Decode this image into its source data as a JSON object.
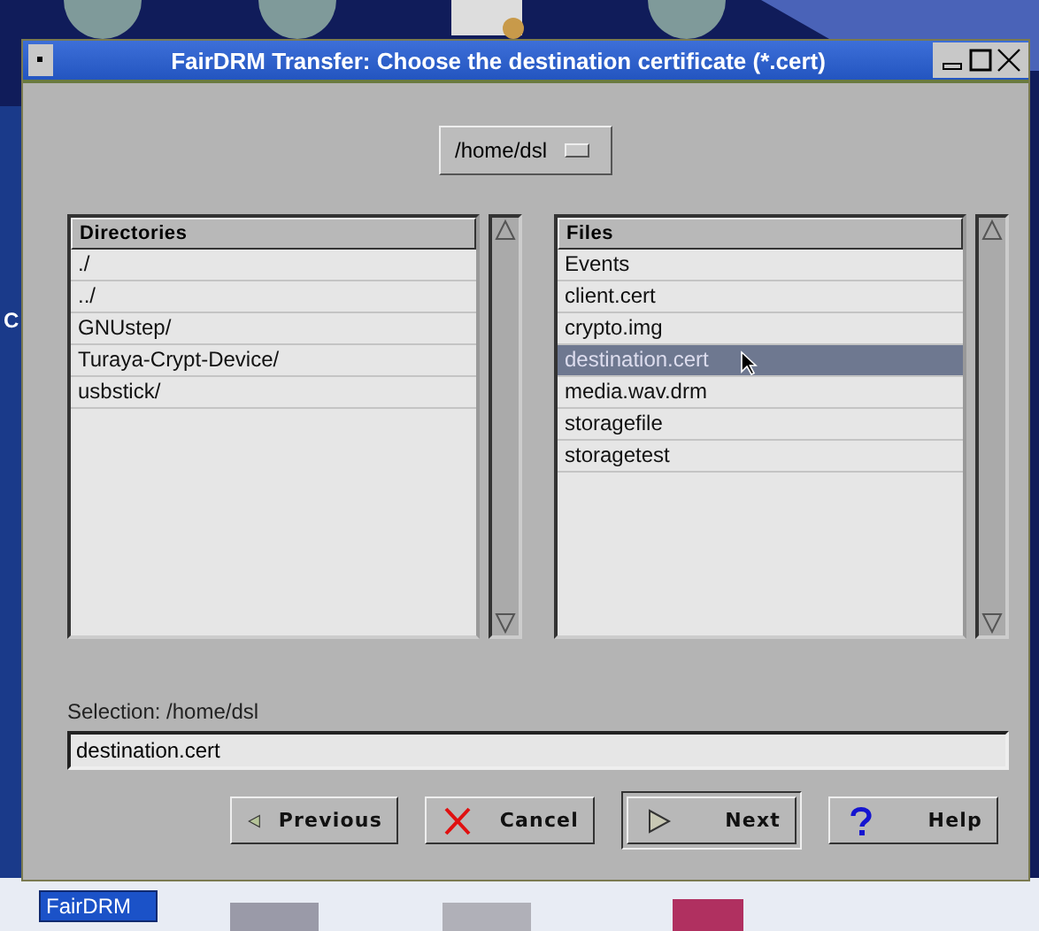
{
  "desktop": {
    "label": "C",
    "taskbar_label": "FairDRM"
  },
  "window": {
    "title": "FairDRM Transfer: Choose the destination certificate (*.cert)"
  },
  "path_dropdown": {
    "value": "/home/dsl"
  },
  "directories": {
    "header": "Directories",
    "items": [
      {
        "label": "./",
        "selected": false
      },
      {
        "label": "../",
        "selected": false
      },
      {
        "label": "GNUstep/",
        "selected": false
      },
      {
        "label": "Turaya-Crypt-Device/",
        "selected": false
      },
      {
        "label": "usbstick/",
        "selected": false
      }
    ]
  },
  "files": {
    "header": "Files",
    "items": [
      {
        "label": "Events",
        "selected": false
      },
      {
        "label": "client.cert",
        "selected": false
      },
      {
        "label": "crypto.img",
        "selected": false
      },
      {
        "label": "destination.cert",
        "selected": true
      },
      {
        "label": "media.wav.drm",
        "selected": false
      },
      {
        "label": "storagefile",
        "selected": false
      },
      {
        "label": "storagetest",
        "selected": false
      }
    ]
  },
  "selection": {
    "label": "Selection: /home/dsl",
    "value": "destination.cert"
  },
  "buttons": [
    {
      "kind": "previous",
      "label": "Previous",
      "default": false
    },
    {
      "kind": "cancel",
      "label": "Cancel",
      "default": false
    },
    {
      "kind": "next",
      "label": "Next",
      "default": true
    },
    {
      "kind": "help",
      "label": "Help",
      "default": false
    }
  ]
}
